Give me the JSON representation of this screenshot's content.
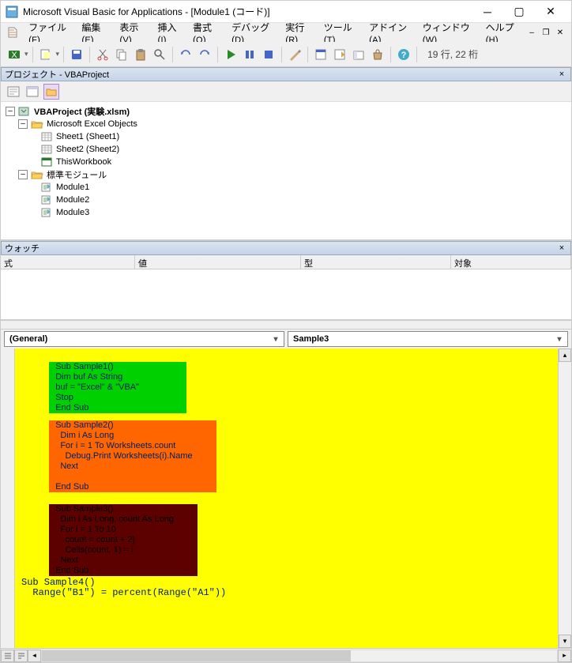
{
  "titlebar": {
    "title": "Microsoft Visual Basic for Applications - [Module1 (コード)]"
  },
  "menu": {
    "items": [
      {
        "label": "ファイル",
        "key": "F"
      },
      {
        "label": "編集",
        "key": "E"
      },
      {
        "label": "表示",
        "key": "V"
      },
      {
        "label": "挿入",
        "key": "I"
      },
      {
        "label": "書式",
        "key": "O"
      },
      {
        "label": "デバッグ",
        "key": "D"
      },
      {
        "label": "実行",
        "key": "R"
      },
      {
        "label": "ツール",
        "key": "T"
      },
      {
        "label": "アドイン",
        "key": "A"
      },
      {
        "label": "ウィンドウ",
        "key": "W"
      },
      {
        "label": "ヘルプ",
        "key": "H"
      }
    ]
  },
  "toolbar": {
    "status": "19 行, 22 桁"
  },
  "project_panel": {
    "title": "プロジェクト - VBAProject",
    "root": "VBAProject (実験.xlsm)",
    "excel_objects": "Microsoft Excel Objects",
    "sheets": [
      "Sheet1 (Sheet1)",
      "Sheet2 (Sheet2)",
      "ThisWorkbook"
    ],
    "std_modules": "標準モジュール",
    "modules": [
      "Module1",
      "Module2",
      "Module3"
    ]
  },
  "watch": {
    "title": "ウォッチ",
    "cols": [
      "式",
      "値",
      "型",
      "対象"
    ]
  },
  "code_dd": {
    "left": "(General)",
    "right": "Sample3"
  },
  "code": {
    "block1": "Sub Sample1()\nDim buf As String\nbuf = \"Excel\" & \"VBA\"\nStop\nEnd Sub",
    "block2": "Sub Sample2()\n  Dim i As Long\n  For i = 1 To Worksheets.count\n    Debug.Print Worksheets(i).Name\n  Next\n\nEnd Sub",
    "block3": "Sub Sample3()\n  Dim i As Long, count As Long\n  For i = 1 To 10\n    count = count + 2|\n    Cells(count, 1) = i\n  Next\nEnd Sub",
    "block4": "Sub Sample4()\n  Range(\"B1\") = percent(Range(\"A1\"))"
  }
}
